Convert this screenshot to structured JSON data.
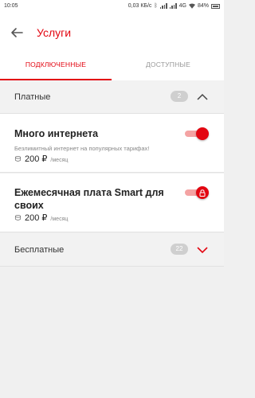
{
  "status_bar": {
    "time": "10:05",
    "speed": "0,03 КБ/с",
    "network": "4G",
    "battery": "84%"
  },
  "header": {
    "title": "Услуги",
    "back_icon": "arrow-left-icon"
  },
  "tabs": [
    {
      "label": "ПОДКЛЮЧЕННЫЕ",
      "active": true
    },
    {
      "label": "ДОСТУПНЫЕ",
      "active": false
    }
  ],
  "paid_group": {
    "label": "Платные",
    "count": "2",
    "expanded": true
  },
  "services": [
    {
      "name": "Много интернета",
      "description": "Безлимитный интернет на популярных тарифах!",
      "price": "200 ₽",
      "period": "/месяц",
      "enabled": true,
      "locked": false
    },
    {
      "name": "Ежемесячная плата Smart для своих",
      "price": "200 ₽",
      "period": "/месяц",
      "enabled": true,
      "locked": true
    }
  ],
  "free_group": {
    "label": "Бесплатные",
    "count": "22",
    "expanded": false
  },
  "colors": {
    "accent": "#e30611",
    "toggle_track": "#f4a3a3",
    "badge": "#cfcfcf"
  }
}
